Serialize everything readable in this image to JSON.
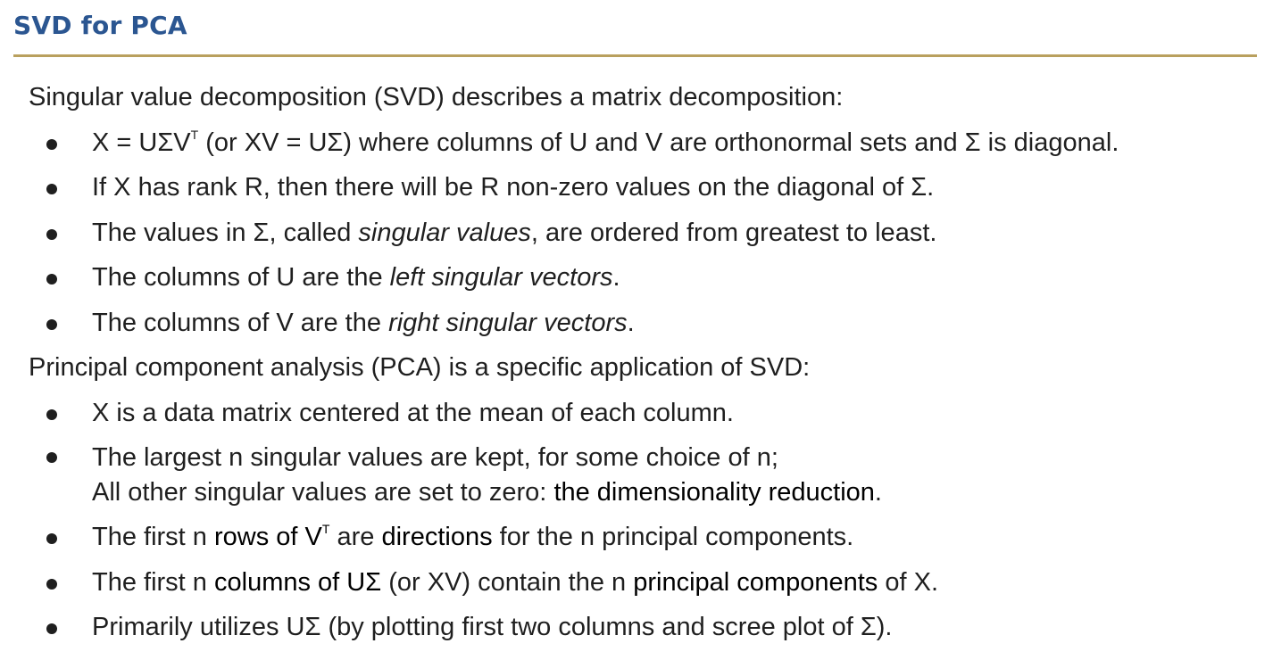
{
  "title": "SVD for PCA",
  "svd": {
    "intro": "Singular value decomposition (SVD) describes a matrix decomposition:",
    "b1": {
      "a": "X = UΣV",
      "sup": "T",
      "b": " (or XV = UΣ) where columns of U and V are orthonormal sets and Σ is diagonal."
    },
    "b2": "If X has rank R, then there will be R non-zero values on the diagonal of Σ.",
    "b3": {
      "a": "The values in Σ, called ",
      "em": "singular values",
      "b": ", are ordered from greatest to least."
    },
    "b4": {
      "a": "The columns of U are the ",
      "em": "left singular vectors",
      "b": "."
    },
    "b5": {
      "a": "The columns of V are the ",
      "em": "right singular vectors",
      "b": "."
    }
  },
  "pca": {
    "intro": "Principal component analysis (PCA) is a specific application of SVD:",
    "b1": "X is a data matrix centered at the mean of each column.",
    "b2": {
      "line1": "The largest n singular values are kept, for some choice of n;",
      "line2a": "All other singular values are set to zero: ",
      "strong": "the dimensionality reduction",
      "line2b": "."
    },
    "b3": {
      "a": "The first n ",
      "strong1": "rows of V",
      "sup": "T",
      "b": " are ",
      "strong2": "directions",
      "c": " for the n principal components."
    },
    "b4": {
      "a": "The first n ",
      "strong1": "columns of UΣ",
      "b": " (or XV) contain the n ",
      "strong2": "principal components",
      "c": " of X."
    },
    "b5": "Primarily utilizes UΣ (by plotting first two columns and scree plot of Σ)."
  }
}
